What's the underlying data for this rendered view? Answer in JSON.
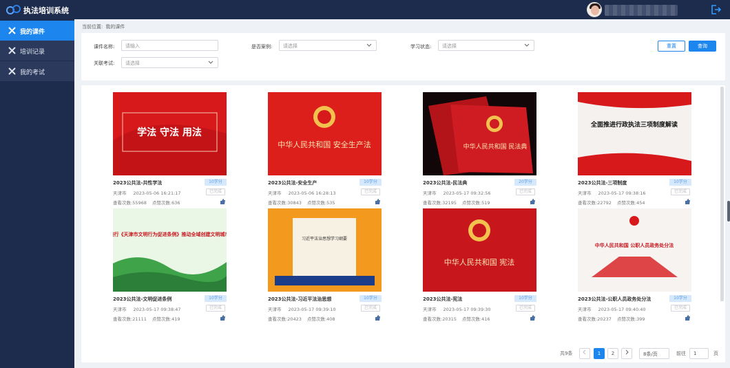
{
  "app": {
    "title": "执法培训系统"
  },
  "sidebar": {
    "items": [
      {
        "label": "我的课件",
        "icon": "wrench-cross-icon",
        "active": true
      },
      {
        "label": "培训记录",
        "icon": "wrench-cross-icon",
        "active": false
      },
      {
        "label": "我的考试",
        "icon": "wrench-cross-icon",
        "active": false
      }
    ]
  },
  "breadcrumb": {
    "prefix": "当前位置:",
    "current": "我的课件"
  },
  "filter": {
    "name_label": "课件名称:",
    "name_placeholder": "请输入",
    "case_label": "是否案例:",
    "case_placeholder": "请选择",
    "status_label": "学习状态:",
    "status_placeholder": "请选择",
    "exam_label": "关联考试:",
    "exam_placeholder": "请选择",
    "reset_label": "重置",
    "search_label": "查询"
  },
  "courses": [
    {
      "title": "2023公共法-共性学法",
      "tag": "10学分",
      "city": "天津市",
      "date": "2023-05-06 16:21:17",
      "button": "已完成",
      "views": "查看次数:55968",
      "likes": "点赞次数:636",
      "thumb": "学法 守法 用法"
    },
    {
      "title": "2023公共法-安全生产",
      "tag": "10学分",
      "city": "天津市",
      "date": "2023-05-06 16:28:13",
      "button": "已完成",
      "views": "查看次数:30843",
      "likes": "点赞次数:535",
      "thumb": "中华人民共和国 安全生产法"
    },
    {
      "title": "2023公共法-民法典",
      "tag": "20学分",
      "city": "天津市",
      "date": "2023-05-17 09:32:56",
      "button": "已完成",
      "views": "查看次数:32195",
      "likes": "点赞次数:519",
      "thumb": "中华人民共和国 民法典"
    },
    {
      "title": "2023公共法-三项制度",
      "tag": "10学分",
      "city": "天津市",
      "date": "2023-05-17 09:38:16",
      "button": "已完成",
      "views": "查看次数:22792",
      "likes": "点赞次数:454",
      "thumb": "全面推进行政执法三项制度解读"
    },
    {
      "title": "2023公共法-文明促进条例",
      "tag": "10学分",
      "city": "天津市",
      "date": "2023-05-17 09:38:47",
      "button": "已完成",
      "views": "查看次数:21111",
      "likes": "点赞次数:419",
      "thumb": "践行《天津市文明行为促进条例》推动全域创建文明城市"
    },
    {
      "title": "2023公共法-习近平法治思想",
      "tag": "10学分",
      "city": "天津市",
      "date": "2023-05-17 09:39:10",
      "button": "已完成",
      "views": "查看次数:20423",
      "likes": "点赞次数:408",
      "thumb": "习近平法治思想学习纲要"
    },
    {
      "title": "2023公共法-宪法",
      "tag": "10学分",
      "city": "天津市",
      "date": "2023-05-17 09:39:30",
      "button": "已完成",
      "views": "查看次数:20315",
      "likes": "点赞次数:416",
      "thumb": "中华人民共和国 宪法"
    },
    {
      "title": "2023公共法-公职人员政务处分法",
      "tag": "10学分",
      "city": "天津市",
      "date": "2023-05-17 09:40:40",
      "button": "已完成",
      "views": "查看次数:20237",
      "likes": "点赞次数:399",
      "thumb": "中华人民共和国 公职人员政务处分法"
    }
  ],
  "pagination": {
    "total": "共9条",
    "pages": [
      "1",
      "2"
    ],
    "current": "1",
    "page_size": "8条/页",
    "goto_label": "前往",
    "goto_value": "1",
    "page_suffix": "页"
  },
  "colors": {
    "nav": "#1d2b4c",
    "accent": "#1c86ee",
    "red": "#c8161d"
  }
}
